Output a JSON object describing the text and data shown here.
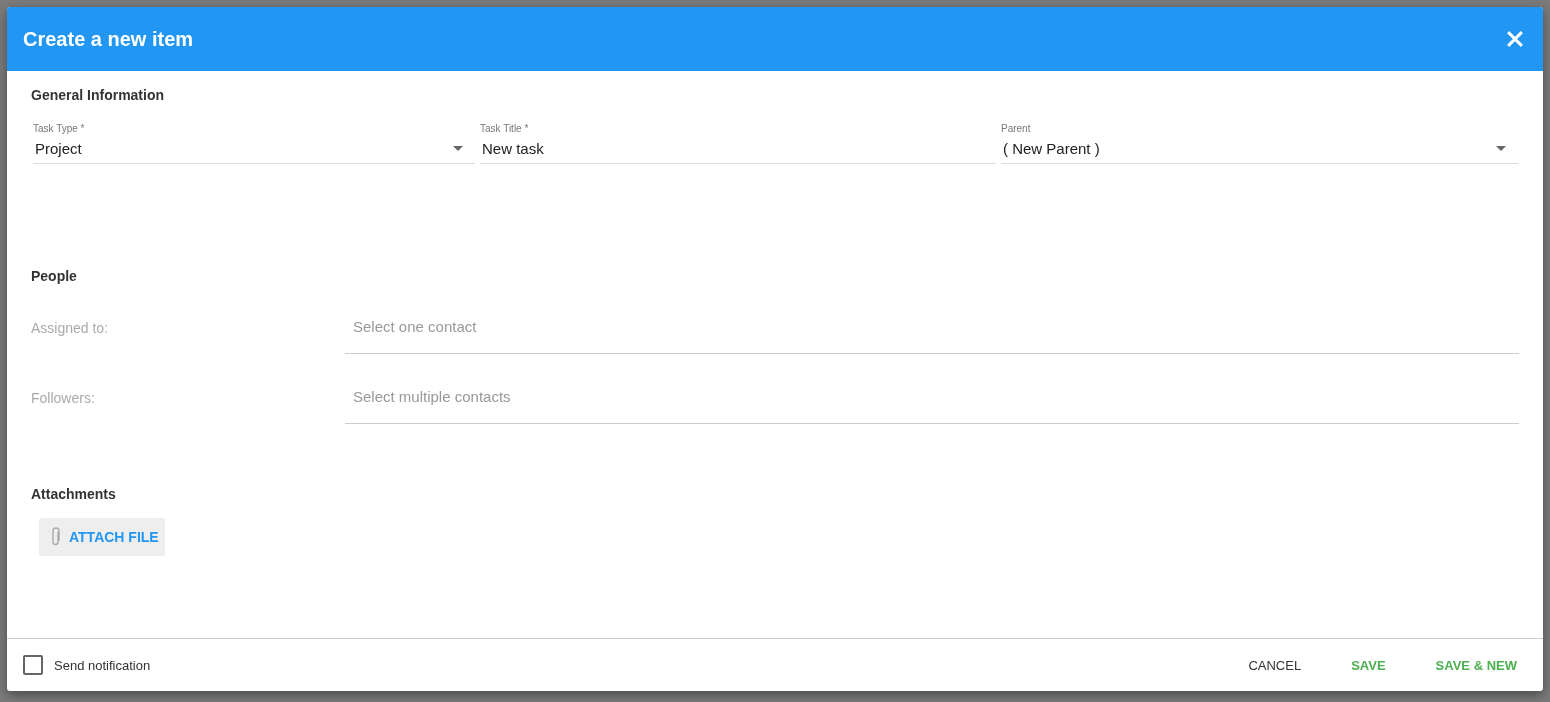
{
  "dialog": {
    "title": "Create a new item"
  },
  "general": {
    "heading": "General Information",
    "fields": [
      {
        "kind": "select",
        "label": "Task Type *",
        "value": "Project"
      },
      {
        "kind": "text",
        "label": "Task Title *",
        "value": "New task"
      },
      {
        "kind": "select",
        "label": "Parent",
        "value": "( New Parent )"
      }
    ]
  },
  "people": {
    "heading": "People",
    "rows": [
      {
        "label": "Assigned to:",
        "placeholder": "Select one contact"
      },
      {
        "label": "Followers:",
        "placeholder": "Select multiple contacts"
      }
    ]
  },
  "attachments": {
    "heading": "Attachments",
    "button": "ATTACH FILE"
  },
  "footer": {
    "notification": {
      "label": "Send notification",
      "checked": false
    },
    "buttons": [
      {
        "kind": "neutral",
        "label": "CANCEL"
      },
      {
        "kind": "primary",
        "label": "SAVE"
      },
      {
        "kind": "primary",
        "label": "SAVE & NEW"
      }
    ]
  }
}
